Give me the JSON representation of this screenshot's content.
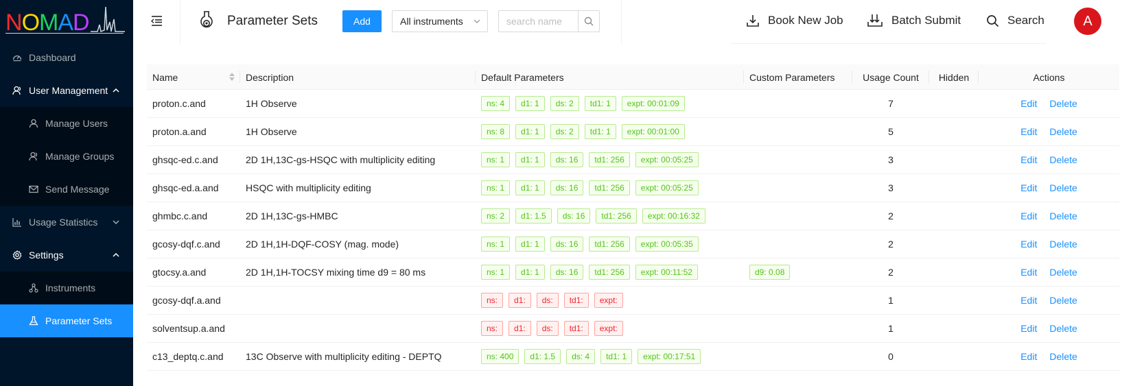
{
  "app": {
    "logo_text": "NOMAD",
    "logo_colors": [
      "#ff2a2a",
      "#ffd400",
      "#23d160",
      "#1890ff",
      "#c03cff"
    ]
  },
  "sidebar": {
    "items": [
      {
        "label": "Dashboard",
        "icon": "dashboard-icon"
      },
      {
        "label": "User Management",
        "icon": "users-icon",
        "expanded": true,
        "children": [
          {
            "label": "Manage Users",
            "icon": "user-icon"
          },
          {
            "label": "Manage Groups",
            "icon": "group-icon"
          },
          {
            "label": "Send Message",
            "icon": "mail-icon"
          }
        ]
      },
      {
        "label": "Usage Statistics",
        "icon": "bar-chart-icon",
        "expanded": false
      },
      {
        "label": "Settings",
        "icon": "gear-icon",
        "expanded": true,
        "children": [
          {
            "label": "Instruments",
            "icon": "instrument-icon"
          },
          {
            "label": "Parameter Sets",
            "icon": "flask-icon",
            "selected": true
          }
        ]
      }
    ]
  },
  "header": {
    "title": "Parameter Sets",
    "add_label": "Add",
    "instrument_select": "All instruments",
    "search_placeholder": "search name",
    "book_new_job": "Book New Job",
    "batch_submit": "Batch Submit",
    "search_label": "Search",
    "avatar_letter": "A",
    "accent": "#1890ff",
    "avatar_color": "#d9161c"
  },
  "table": {
    "columns": [
      "Name",
      "Description",
      "Default Parameters",
      "Custom Parameters",
      "Usage Count",
      "Hidden",
      "Actions"
    ],
    "edit_label": "Edit",
    "delete_label": "Delete",
    "rows": [
      {
        "name": "proton.c.and",
        "description": "1H Observe",
        "status": "green",
        "defaults": [
          "ns: 4",
          "d1: 1",
          "ds: 2",
          "td1: 1",
          "expt: 00:01:09"
        ],
        "custom": [],
        "count": "7"
      },
      {
        "name": "proton.a.and",
        "description": "1H Observe",
        "status": "green",
        "defaults": [
          "ns: 8",
          "d1: 1",
          "ds: 2",
          "td1: 1",
          "expt: 00:01:00"
        ],
        "custom": [],
        "count": "5"
      },
      {
        "name": "ghsqc-ed.c.and",
        "description": "2D 1H,13C-gs-HSQC with multiplicity editing",
        "status": "green",
        "defaults": [
          "ns: 1",
          "d1: 1",
          "ds: 16",
          "td1: 256",
          "expt: 00:05:25"
        ],
        "custom": [],
        "count": "3"
      },
      {
        "name": "ghsqc-ed.a.and",
        "description": "HSQC with multiplicity editing",
        "status": "green",
        "defaults": [
          "ns: 1",
          "d1: 1",
          "ds: 16",
          "td1: 256",
          "expt: 00:05:25"
        ],
        "custom": [],
        "count": "3"
      },
      {
        "name": "ghmbc.c.and",
        "description": "2D 1H,13C-gs-HMBC",
        "status": "green",
        "defaults": [
          "ns: 2",
          "d1: 1.5",
          "ds: 16",
          "td1: 256",
          "expt: 00:16:32"
        ],
        "custom": [],
        "count": "2"
      },
      {
        "name": "gcosy-dqf.c.and",
        "description": "2D 1H,1H-DQF-COSY (mag. mode)",
        "status": "green",
        "defaults": [
          "ns: 1",
          "d1: 1",
          "ds: 16",
          "td1: 256",
          "expt: 00:05:35"
        ],
        "custom": [],
        "count": "2"
      },
      {
        "name": "gtocsy.a.and",
        "description": "2D 1H,1H-TOCSY mixing time d9 = 80 ms",
        "status": "green",
        "defaults": [
          "ns: 1",
          "d1: 1",
          "ds: 16",
          "td1: 256",
          "expt: 00:11:52"
        ],
        "custom": [
          "d9: 0.08"
        ],
        "count": "2"
      },
      {
        "name": "gcosy-dqf.a.and",
        "description": "",
        "status": "red",
        "defaults": [
          "ns:",
          "d1:",
          "ds:",
          "td1:",
          "expt:"
        ],
        "custom": [],
        "count": "1"
      },
      {
        "name": "solventsup.a.and",
        "description": "",
        "status": "red",
        "defaults": [
          "ns:",
          "d1:",
          "ds:",
          "td1:",
          "expt:"
        ],
        "custom": [],
        "count": "1"
      },
      {
        "name": "c13_deptq.c.and",
        "description": "13C Observe with multiplicity editing - DEPTQ",
        "status": "green",
        "defaults": [
          "ns: 400",
          "d1: 1.5",
          "ds: 4",
          "td1: 1",
          "expt: 00:17:51"
        ],
        "custom": [],
        "count": "0"
      }
    ]
  }
}
